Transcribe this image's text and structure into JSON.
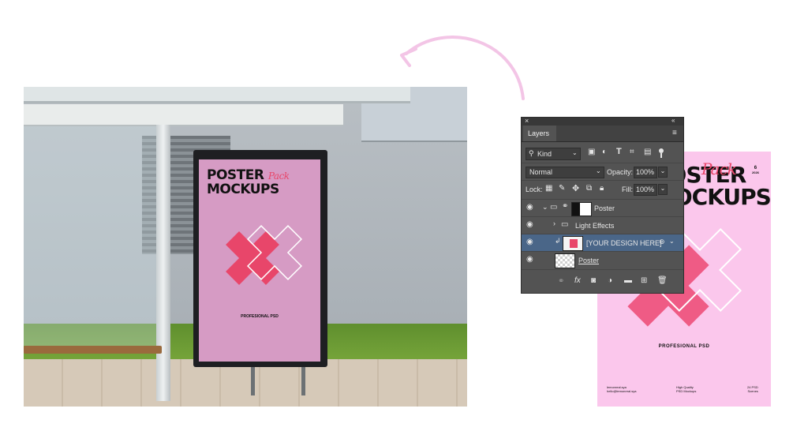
{
  "layers_panel": {
    "tab_label": "Layers",
    "filter_label": "Kind",
    "blend_mode": "Normal",
    "opacity_label": "Opacity:",
    "opacity_value": "100%",
    "lock_label": "Lock:",
    "fill_label": "Fill:",
    "fill_value": "100%",
    "layers": [
      {
        "name": "Poster",
        "type": "group"
      },
      {
        "name": "Light Effects",
        "type": "group"
      },
      {
        "name": "[YOUR DESIGN HERE]",
        "type": "smart-object"
      },
      {
        "name": "Poster",
        "type": "layer"
      }
    ],
    "icons": [
      "close-icon",
      "collapse-icon",
      "menu-icon",
      "search-icon",
      "image-filter-icon",
      "adjustment-filter-icon",
      "type-filter-icon",
      "shape-filter-icon",
      "smart-filter-icon",
      "toggle-filter-icon",
      "lock-pixels-icon",
      "lock-brush-icon",
      "lock-move-icon",
      "lock-artboard-icon",
      "lock-all-icon",
      "eye-icon",
      "link-icon",
      "fx-icon",
      "mask-icon",
      "adjustment-icon",
      "folder-icon",
      "new-layer-icon",
      "trash-icon"
    ]
  },
  "poster": {
    "title_line1": "POSTER",
    "title_script": "Pack",
    "title_line2": "MOCKUPS",
    "corner_num": "6",
    "corner_year": "2026",
    "mid_label": "PROFESIONAL PSD",
    "foot_left": "lemonreal.sya\nhello@lemonreal.sya",
    "foot_mid": "High Quality\nPSD Mockups",
    "foot_right": "24 PSD\nScenes"
  },
  "colors": {
    "accent_arrow": "#f3c5e6",
    "poster_pink": "#fbc7ec",
    "poster_pink_scene": "#d69bc4",
    "cross_red": "#e8466a",
    "panel_bg": "#535353",
    "selected_row": "#4a6688"
  }
}
